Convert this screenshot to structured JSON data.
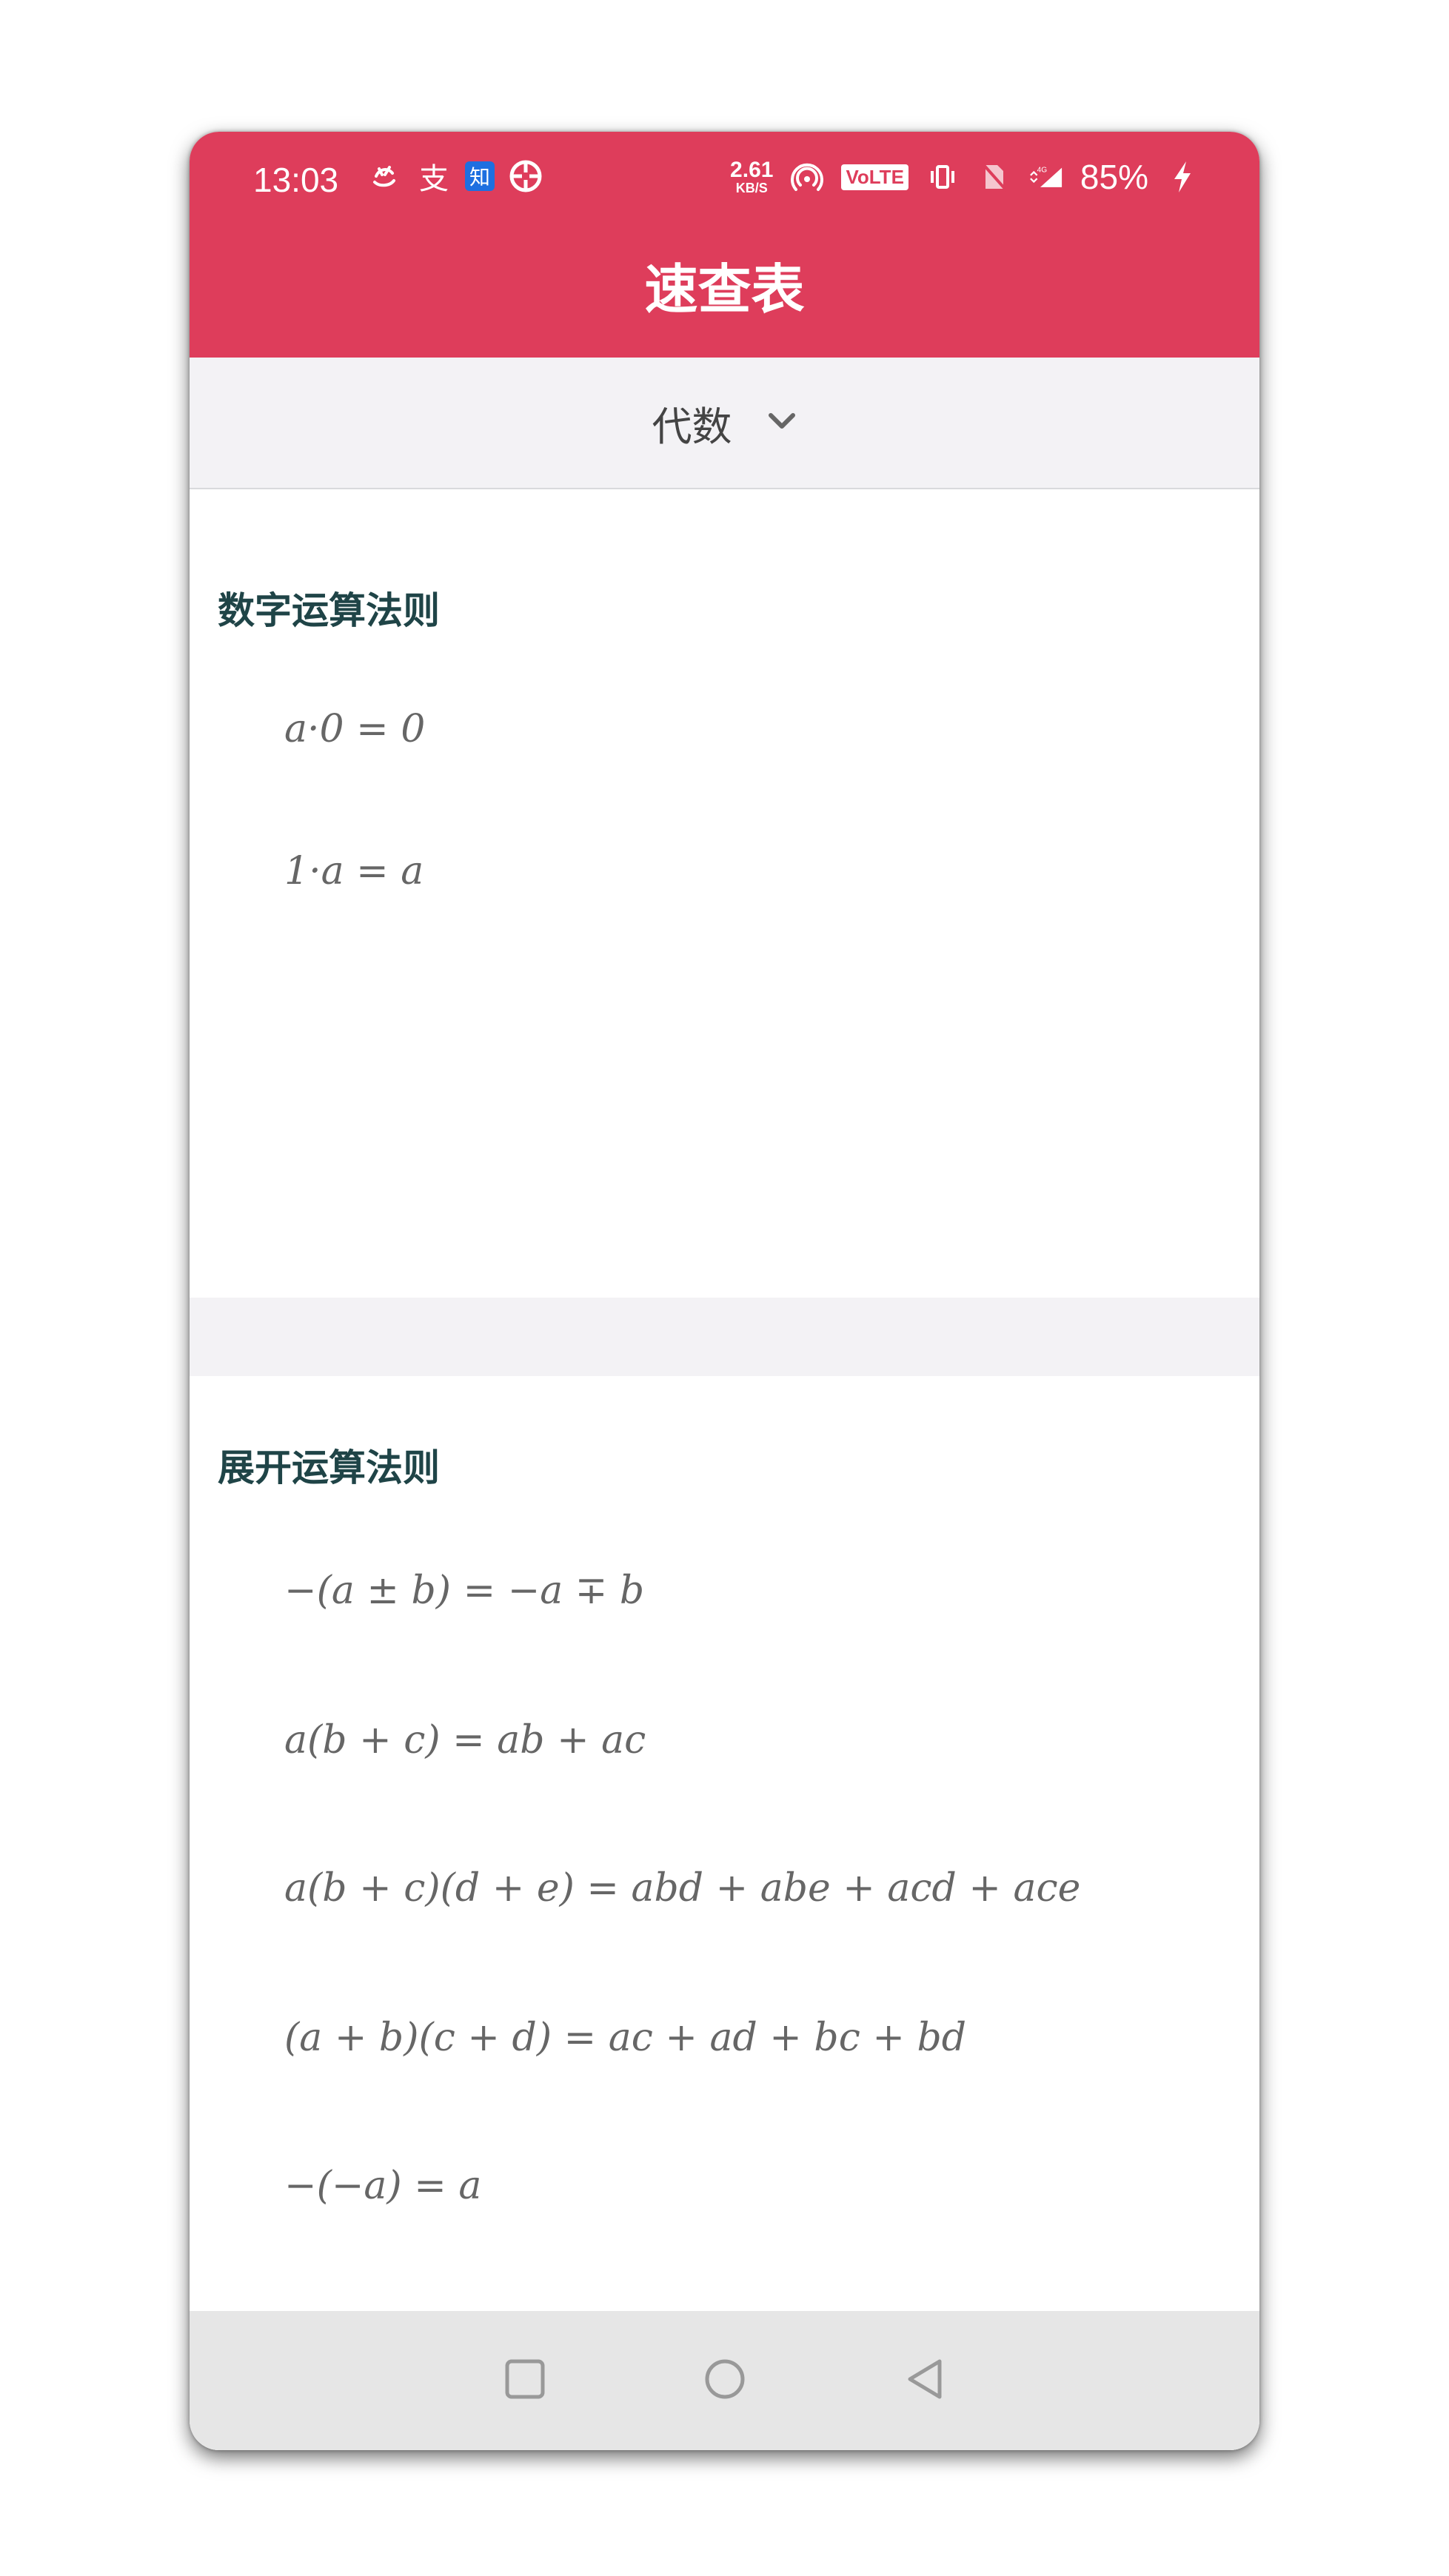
{
  "status_bar": {
    "time": "13:03",
    "net_speed_value": "2.61",
    "net_speed_unit": "KB/S",
    "volte": "VoLTE",
    "network": "4G",
    "battery": "85%",
    "left_icons": [
      "uc-browser-icon",
      "alipay-icon",
      "zhihu-icon",
      "aperture-icon"
    ],
    "zhihu_glyph": "知",
    "alipay_glyph": "支"
  },
  "header": {
    "title": "速查表"
  },
  "category_dropdown": {
    "selected": "代数"
  },
  "sections": [
    {
      "title": "数字运算法则",
      "formulas": [
        "a·0 = 0",
        "1·a = a"
      ]
    },
    {
      "title": "展开运算法则",
      "formulas": [
        "−(a ± b) = −a ∓ b",
        "a(b + c) = ab + ac",
        "a(b + c)(d + e) = abd + abe + acd + ace",
        "(a + b)(c + d) = ac + ad + bc + bd",
        "−(−a) = a"
      ]
    }
  ],
  "tab_bar": {
    "tabs": [
      {
        "icon": "home-icon",
        "active": false
      },
      {
        "icon": "document-icon",
        "active": false
      },
      {
        "icon": "formula-cards-icon",
        "active": true
      },
      {
        "icon": "menu-icon",
        "active": false
      }
    ],
    "active_color": "#0bbfea"
  },
  "colors": {
    "brand": "#de3d5b",
    "section_title": "#1f4447",
    "tab_icon": "#16b5e0"
  }
}
